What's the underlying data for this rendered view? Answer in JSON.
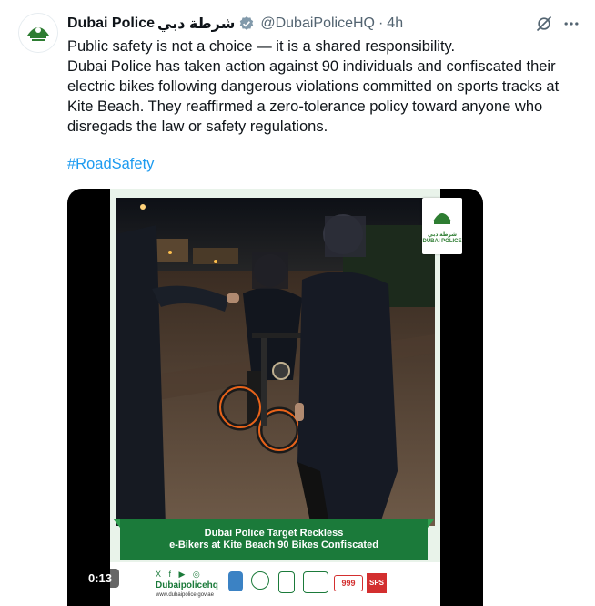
{
  "tweet": {
    "author_name": "Dubai Police",
    "author_name_arabic": "شرطة دبي",
    "handle": "@DubaiPoliceHQ",
    "separator": "·",
    "time": "4h",
    "paragraph1": "Public safety is not a choice — it is a shared responsibility.",
    "paragraph2": "Dubai Police has taken action against 90 individuals and confiscated their electric bikes following dangerous violations committed on sports tracks at Kite Beach. They reaffirmed a zero-tolerance policy toward anyone who disregads the law or safety regulations.",
    "hashtag": "#RoadSafety"
  },
  "media": {
    "banner_line1": "Dubai Police Target Reckless",
    "banner_line2": "e-Bikers at Kite Beach 90 Bikes Confiscated",
    "logo_text": "شرطة دبي",
    "logo_text_en": "DUBAI POLICE",
    "footer_social_icons": "X f ▶ ◎",
    "footer_handle": "Dubaipolicehq",
    "footer_website": "www.dubaipolice.gov.ae",
    "emergency_number": "999",
    "sps_label": "SPS",
    "video_time": "0:13"
  },
  "icons": {
    "verified": "verified-badge-icon",
    "grok": "grok-icon",
    "more": "more-options-icon"
  },
  "colors": {
    "link": "#1d9bf0",
    "verified": "#829aab",
    "brand_green": "#1b7a3a"
  }
}
